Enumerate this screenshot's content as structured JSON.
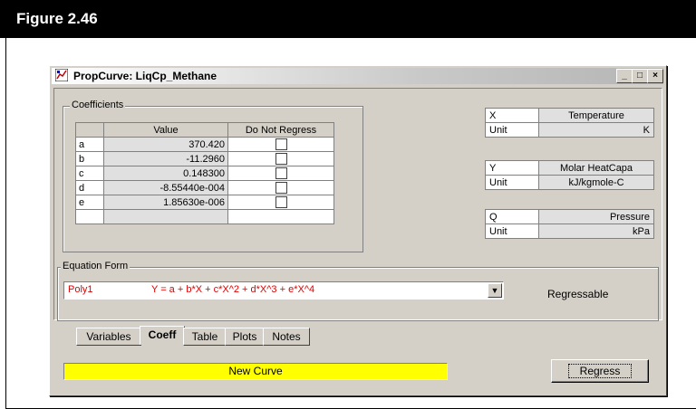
{
  "figure": {
    "label": "Figure 2.46"
  },
  "window": {
    "title": "PropCurve: LiqCp_Methane",
    "controls": {
      "minimize": "_",
      "maximize": "□",
      "close": "×"
    }
  },
  "coefficients": {
    "group_label": "Coefficients",
    "headers": {
      "value": "Value",
      "do_not_regress": "Do Not Regress"
    },
    "rows": [
      {
        "name": "a",
        "value": "370.420",
        "checked": false
      },
      {
        "name": "b",
        "value": "-11.2960",
        "checked": false
      },
      {
        "name": "c",
        "value": "0.148300",
        "checked": false
      },
      {
        "name": "d",
        "value": "-8.55440e-004",
        "checked": false
      },
      {
        "name": "e",
        "value": "1.85630e-006",
        "checked": false
      },
      {
        "name": "",
        "value": "",
        "checked": null
      }
    ]
  },
  "variables_x": {
    "key": "X",
    "name": "Temperature",
    "unit_label": "Unit",
    "unit": "K"
  },
  "variables_y": {
    "key": "Y",
    "name": "Molar HeatCapa",
    "unit_label": "Unit",
    "unit": "kJ/kgmole-C"
  },
  "variables_q": {
    "key": "Q",
    "name": "Pressure",
    "unit_label": "Unit",
    "unit": "kPa"
  },
  "equation": {
    "group_label": "Equation Form",
    "type": "Poly1",
    "formula": "Y = a + b*X + c*X^2 + d*X^3 + e*X^4",
    "status": "Regressable"
  },
  "tabs": [
    "Variables",
    "Coeff",
    "Table",
    "Plots",
    "Notes"
  ],
  "active_tab": "Coeff",
  "status_bar": {
    "text": "New Curve",
    "color": "#ffff00"
  },
  "regress_button": {
    "label": "Regress"
  },
  "colors": {
    "window_bg": "#d4d0c8",
    "equation_text": "#e00000"
  }
}
